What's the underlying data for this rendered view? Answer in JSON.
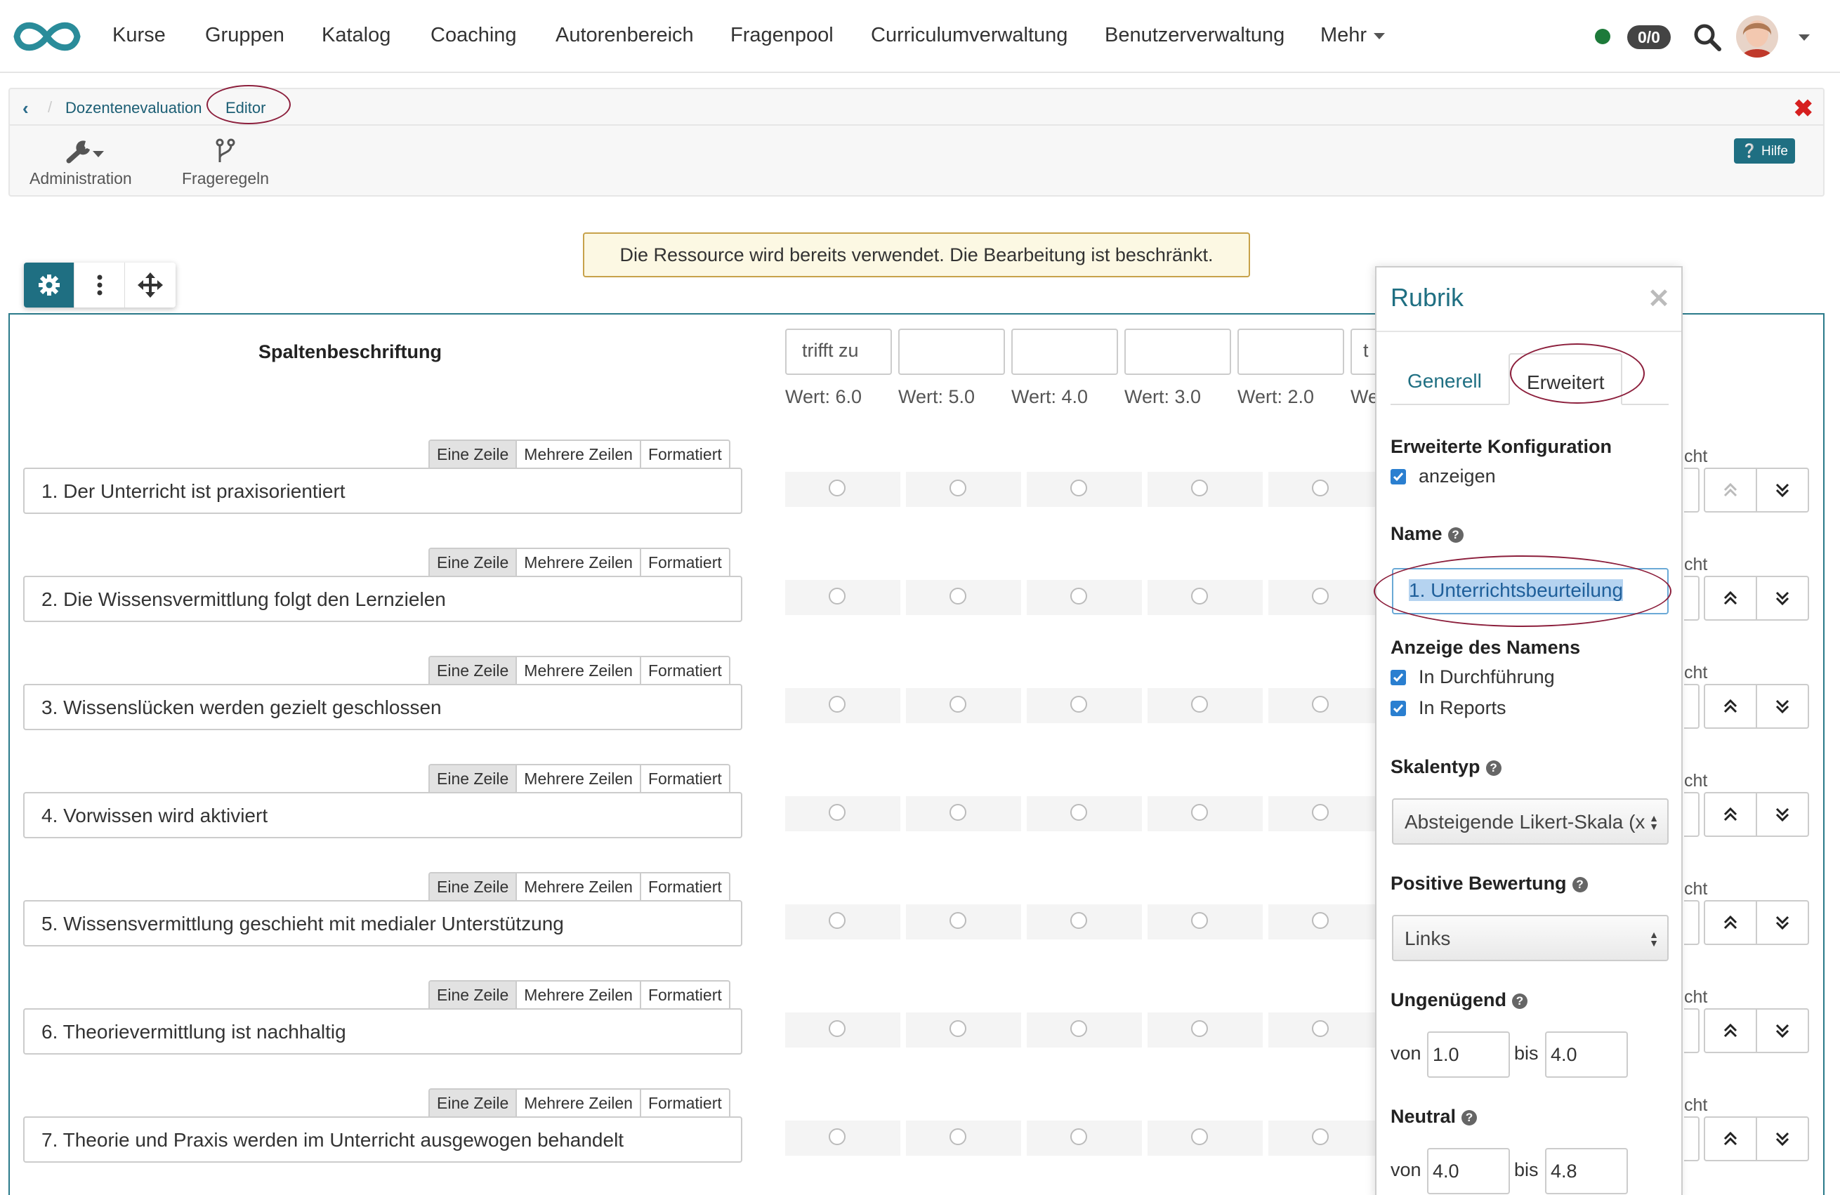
{
  "nav": {
    "items": [
      "Kurse",
      "Gruppen",
      "Katalog",
      "Coaching",
      "Autorenbereich",
      "Fragenpool",
      "Curriculumverwaltung",
      "Benutzerverwaltung"
    ],
    "more": "Mehr",
    "badge": "0/0",
    "status_color": "#1d7a3a"
  },
  "breadcrumb": {
    "items": [
      "Dozentenevaluation",
      "Editor"
    ]
  },
  "toolbar": {
    "administration": "Administration",
    "rules": "Frageregeln",
    "help": "Hilfe"
  },
  "warning": "Die Ressource wird bereits verwendet. Die Bearbeitung ist beschränkt.",
  "rubric": {
    "column_title": "Spaltenbeschriftung",
    "scale_labels": [
      "trifft zu",
      "",
      "",
      "",
      "",
      "t"
    ],
    "values": [
      "Wert: 6.0",
      "Wert: 5.0",
      "Wert: 4.0",
      "Wert: 3.0",
      "Wert: 2.0",
      "We"
    ],
    "modes": [
      "Eine Zeile",
      "Mehrere Zeilen",
      "Formatiert"
    ],
    "weight_label": "cht",
    "questions": [
      "1. Der Unterricht ist praxisorientiert",
      "2. Die Wissensvermittlung folgt den Lernzielen",
      "3. Wissenslücken werden gezielt geschlossen",
      "4. Vorwissen wird aktiviert",
      "5. Wissensvermittlung geschieht mit medialer Unterstützung",
      "6. Theorievermittlung ist nachhaltig",
      "7. Theorie und Praxis werden im Unterricht ausgewogen behandelt"
    ]
  },
  "panel": {
    "title": "Rubrik",
    "tabs": [
      "Generell",
      "Erweitert"
    ],
    "advanced_label": "Erweiterte Konfiguration",
    "advanced_check": "anzeigen",
    "name_label": "Name",
    "name_value": "1. Unterrichtsbeurteilung",
    "name_display_label": "Anzeige des Namens",
    "name_display_run": "In Durchführung",
    "name_display_reports": "In Reports",
    "scale_type_label": "Skalentyp",
    "scale_type_value": "Absteigende Likert-Skala (x",
    "positive_label": "Positive Bewertung",
    "positive_value": "Links",
    "insufficient_label": "Ungenügend",
    "insufficient_from": "1.0",
    "insufficient_to": "4.0",
    "neutral_label": "Neutral",
    "neutral_from": "4.0",
    "neutral_to": "4.8",
    "from": "von",
    "to": "bis"
  },
  "accent_color": "#1f6f82",
  "highlight_color": "#8c1f3c"
}
